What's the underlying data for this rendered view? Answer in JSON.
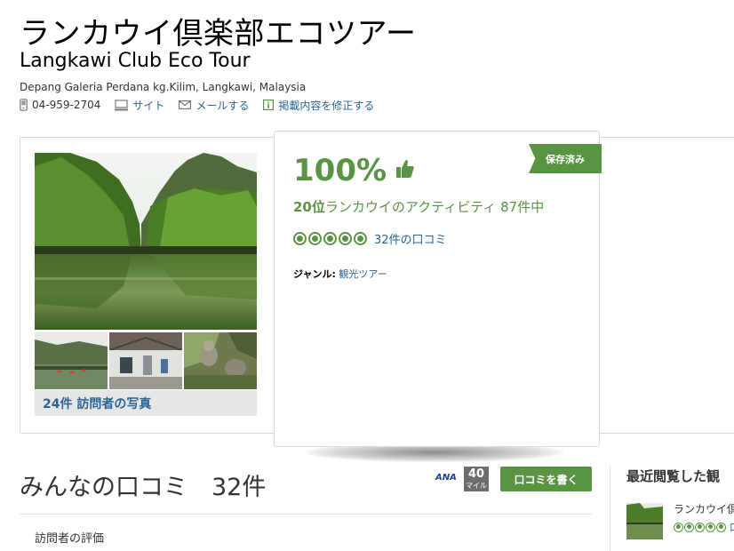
{
  "header": {
    "title_ja": "ランカウイ倶楽部エコツアー",
    "title_en": "Langkawi Club Eco Tour",
    "address": "Depang Galeria Perdana kg.Kilim, Langkawi, Malaysia",
    "phone": "04-959-2704",
    "site_label": "サイト",
    "email_label": "メールする",
    "edit_label": "掲載内容を修正する"
  },
  "photos": {
    "count_label": "24件 訪問者の写真"
  },
  "popup": {
    "percent": "100%",
    "saved_label": "保存済み",
    "rank_num": "20位",
    "rank_text": "ランカウイのアクティビティ",
    "rank_total": "87件中",
    "rating_bubbles": 5,
    "reviews_link": "32件の口コミ",
    "genre_label": "ジャンル:",
    "genre_value": "観光ツアー"
  },
  "reviews": {
    "title": "みんなの口コミ　32件",
    "ana_label": "ANA",
    "miles_value": "40",
    "miles_unit": "マイル",
    "write_button": "口コミを書く",
    "visitor_rating_label": "訪問者の評価"
  },
  "recent": {
    "title": "最近閲覧した観",
    "item_name": "ランカウイ倶",
    "item_rating": 5,
    "item_link": "口"
  },
  "colors": {
    "brand_green": "#589442",
    "link_blue": "#2a6496"
  },
  "icons": [
    "phone-icon",
    "monitor-icon",
    "mail-icon",
    "info-icon",
    "thumbs-up-icon",
    "rating-bubble-icon"
  ]
}
